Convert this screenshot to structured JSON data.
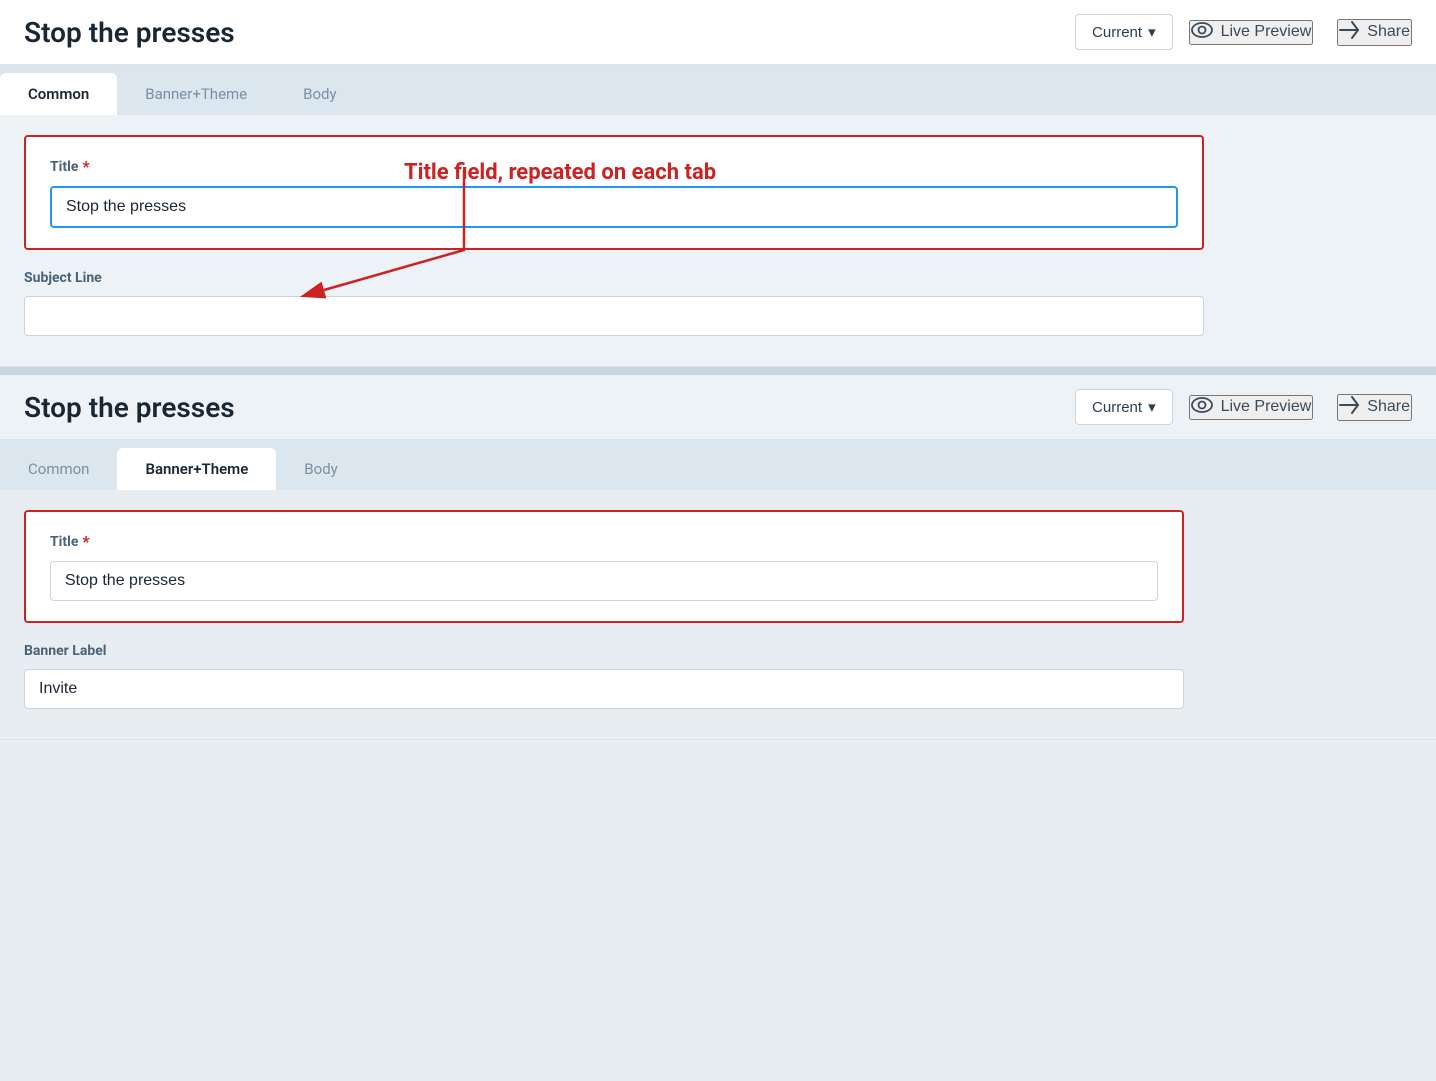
{
  "page": {
    "title": "Stop the presses"
  },
  "header1": {
    "title": "Stop the presses",
    "current_label": "Current",
    "chevron": "▾",
    "live_preview_label": "Live Preview",
    "share_label": "Share"
  },
  "tabs1": {
    "items": [
      {
        "id": "common",
        "label": "Common",
        "active": true
      },
      {
        "id": "banner-theme",
        "label": "Banner+Theme",
        "active": false
      },
      {
        "id": "body",
        "label": "Body",
        "active": false
      }
    ]
  },
  "form1": {
    "title_label": "Title",
    "required_marker": "*",
    "title_value": "Stop the presses",
    "subject_line_label": "Subject Line",
    "subject_line_placeholder": ""
  },
  "annotation": {
    "text": "Title field, repeated on each tab"
  },
  "header2": {
    "title": "Stop the presses",
    "current_label": "Current",
    "chevron": "▾",
    "live_preview_label": "Live Preview",
    "share_label": "Share"
  },
  "tabs2": {
    "items": [
      {
        "id": "common2",
        "label": "Common",
        "active": false
      },
      {
        "id": "banner-theme2",
        "label": "Banner+Theme",
        "active": true
      },
      {
        "id": "body2",
        "label": "Body",
        "active": false
      }
    ]
  },
  "form2": {
    "title_label": "Title",
    "required_marker": "*",
    "title_value": "Stop the presses",
    "banner_label_label": "Banner Label",
    "banner_label_value": "Invite"
  },
  "icons": {
    "eye": "👁",
    "share": "↪",
    "chevron_down": "∨"
  }
}
